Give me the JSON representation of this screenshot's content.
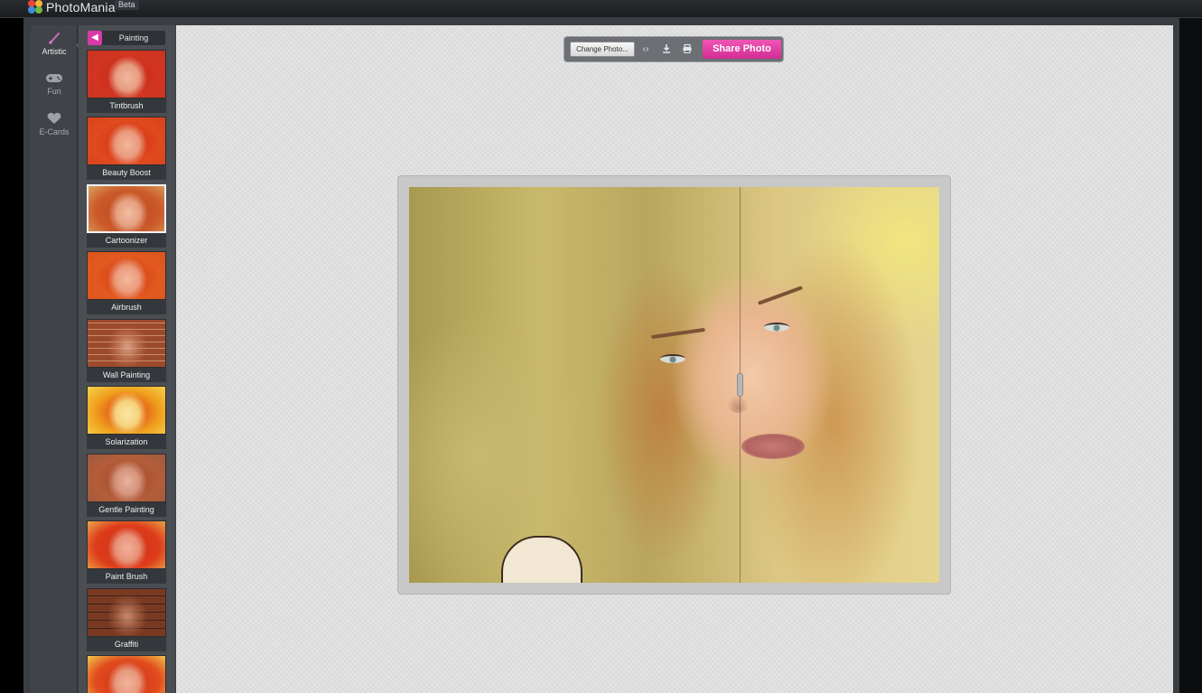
{
  "app": {
    "name": "PhotoMania",
    "badge": "Beta"
  },
  "categories": [
    {
      "label": "Artistic",
      "icon": "brush-icon",
      "active": true
    },
    {
      "label": "Fun",
      "icon": "gamepad-icon",
      "active": false
    },
    {
      "label": "E-Cards",
      "icon": "heart-icon",
      "active": false
    }
  ],
  "effects_panel": {
    "title": "Painting",
    "back_icon": "chevron-left-icon",
    "items": [
      {
        "label": "Tintbrush"
      },
      {
        "label": "Beauty Boost"
      },
      {
        "label": "Cartoonizer",
        "active": true
      },
      {
        "label": "Airbrush"
      },
      {
        "label": "Wall Painting"
      },
      {
        "label": "Solarization"
      },
      {
        "label": "Gentle Painting"
      },
      {
        "label": "Paint Brush"
      },
      {
        "label": "Graffiti"
      },
      {
        "label": ""
      }
    ]
  },
  "toolbar": {
    "change_label": "Change Photo...",
    "compare_icon": "compare-arrows-icon",
    "download_icon": "download-icon",
    "print_icon": "print-icon",
    "share_label": "Share Photo"
  },
  "colors": {
    "accent": "#d93aa6",
    "panel": "#4a4e53",
    "canvas": "#e3e3e3"
  }
}
